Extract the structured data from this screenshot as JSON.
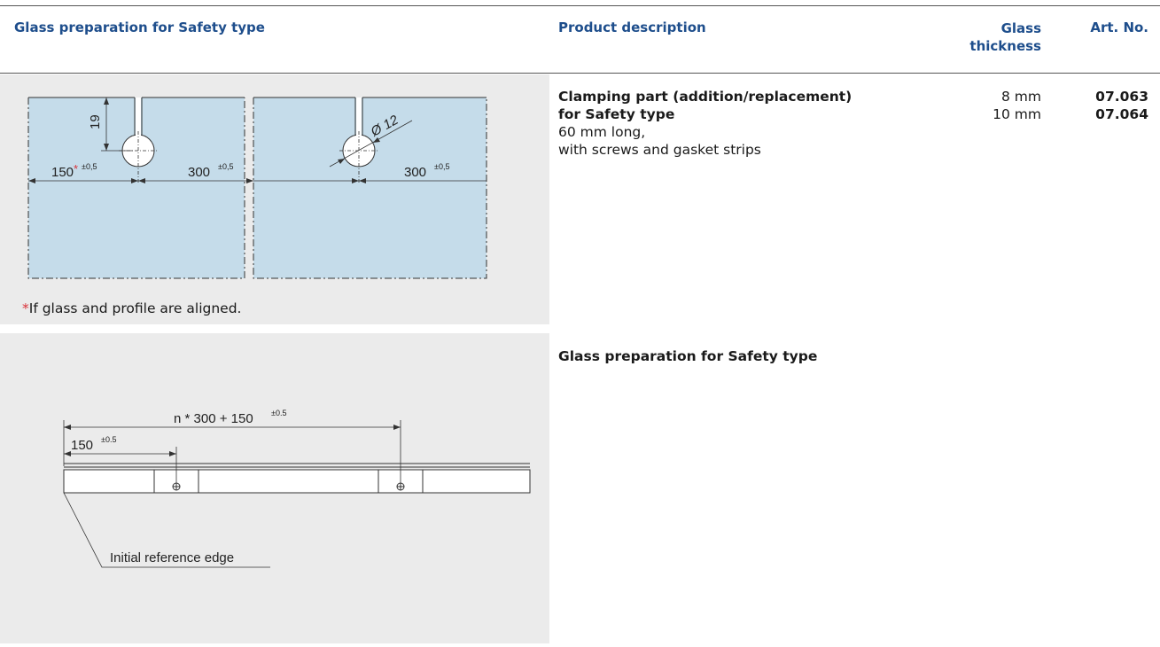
{
  "header": {
    "col_glass_prep": "Glass preparation for Safety type",
    "col_product_desc": "Product description",
    "col_glass_thickness_line1": "Glass",
    "col_glass_thickness_line2": "thickness",
    "col_art_no": "Art. No."
  },
  "row1": {
    "product_title_line1": "Clamping part (addition/replacement)",
    "product_title_line2": "for Safety type",
    "product_detail_line1": "60 mm long,",
    "product_detail_line2": "with screws and gasket strips",
    "thicknesses": [
      "8 mm",
      "10 mm"
    ],
    "art_numbers": [
      "07.063",
      "07.064"
    ],
    "footnote_asterisk": "*",
    "footnote_text": "If glass and profile are aligned.",
    "drawing": {
      "dim_19": "19",
      "dim_150": "150",
      "dim_150_asterisk": "*",
      "tol_05_comma": "±0,5",
      "dim_300_a": "300",
      "dim_300_b": "300",
      "dim_diameter": "Ø 12"
    }
  },
  "row2": {
    "title": "Glass preparation for Safety type",
    "drawing": {
      "formula": "n * 300 + 150",
      "tol_05_dot": "±0.5",
      "dim_150": "150",
      "reference_label": "Initial reference edge"
    }
  },
  "colors": {
    "header_blue": "#1e4e8c",
    "glass_fill": "#c5dcea",
    "panel_grey": "#ebebeb",
    "asterisk_red": "#d9333a"
  }
}
